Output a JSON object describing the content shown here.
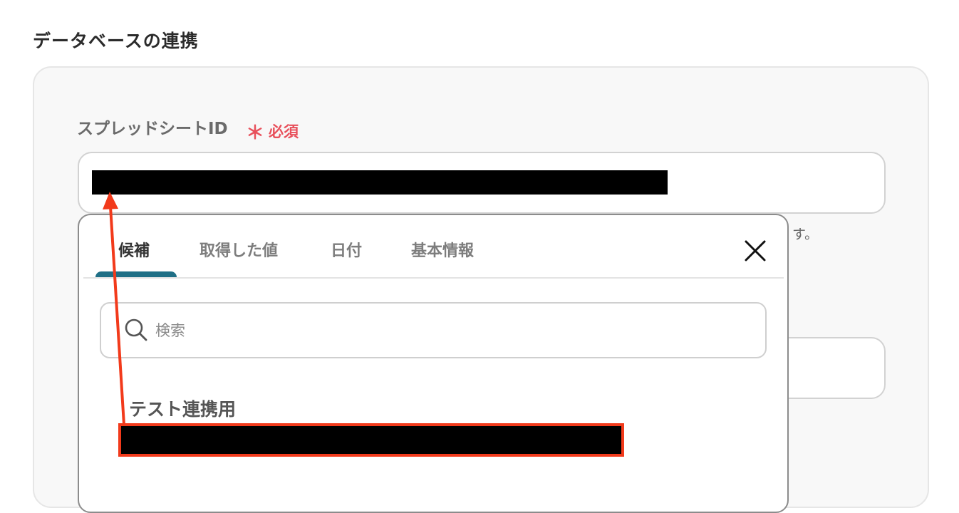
{
  "section": {
    "title": "データベースの連携"
  },
  "field": {
    "label": "スプレッドシートID",
    "required_mark": "＊",
    "required_text": "必須",
    "hint_tail": "す。"
  },
  "popup": {
    "tabs": [
      {
        "label": "候補",
        "active": true
      },
      {
        "label": "取得した値",
        "active": false
      },
      {
        "label": "日付",
        "active": false
      },
      {
        "label": "基本情報",
        "active": false
      }
    ],
    "search": {
      "placeholder": "検索",
      "value": ""
    },
    "option": {
      "title": "テスト連携用"
    }
  },
  "colors": {
    "accent_tab": "#1f6f86",
    "required": "#e8505b",
    "annotation": "#f23a1b"
  },
  "icons": {
    "close": "close-icon",
    "search": "search-icon"
  }
}
